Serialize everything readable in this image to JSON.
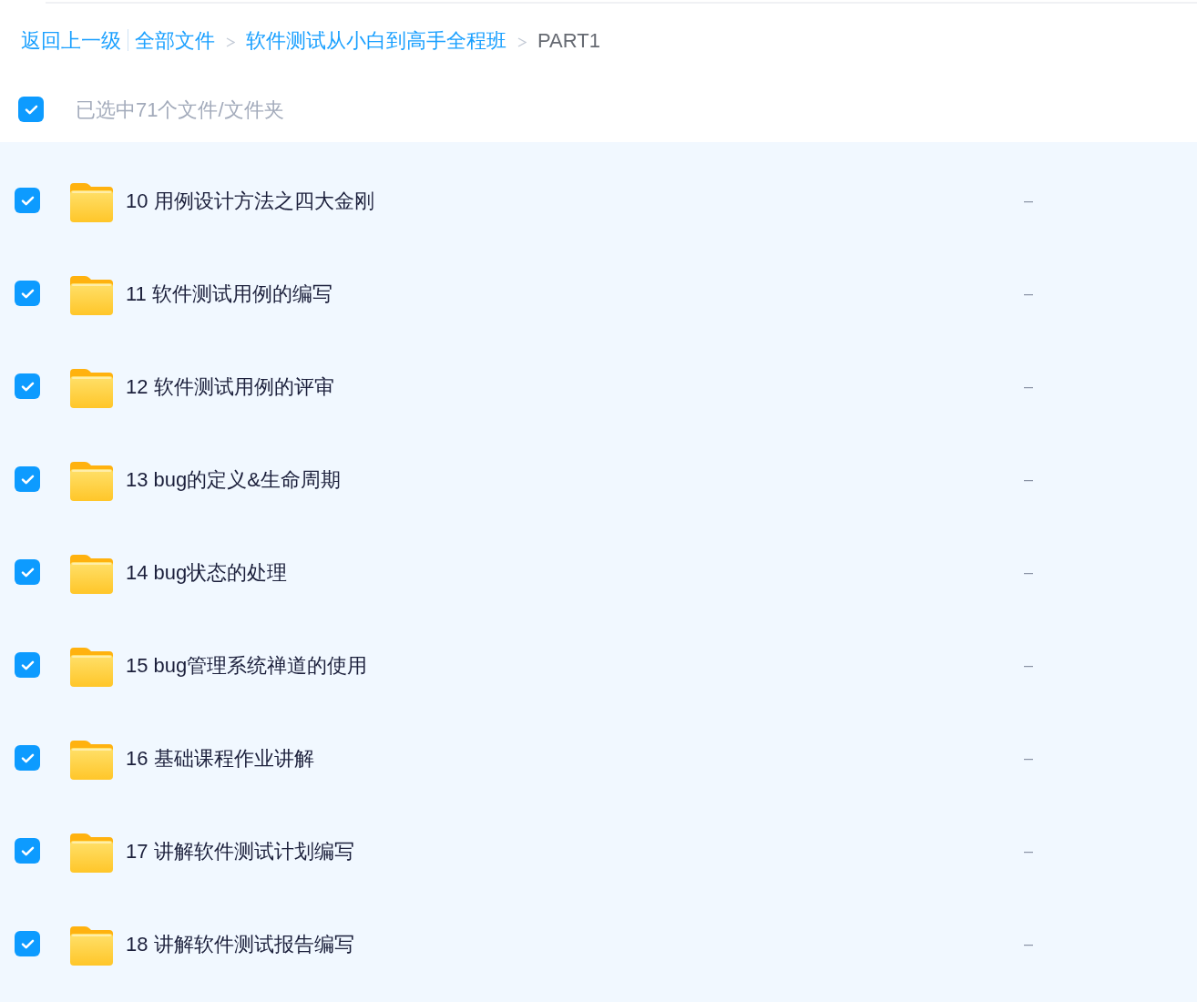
{
  "breadcrumb": {
    "back_link": "返回上一级",
    "items": [
      {
        "label": "全部文件",
        "current": false
      },
      {
        "label": "软件测试从小白到高手全程班",
        "current": false
      },
      {
        "label": "PART1",
        "current": true
      }
    ]
  },
  "select_all": {
    "checked": true,
    "label": "已选中71个文件/文件夹"
  },
  "files": [
    {
      "name": "10 用例设计方法之四大金刚",
      "checked": true,
      "size": "–"
    },
    {
      "name": "11 软件测试用例的编写",
      "checked": true,
      "size": "–"
    },
    {
      "name": "12 软件测试用例的评审",
      "checked": true,
      "size": "–"
    },
    {
      "name": "13 bug的定义&生命周期",
      "checked": true,
      "size": "–"
    },
    {
      "name": "14 bug状态的处理",
      "checked": true,
      "size": "–"
    },
    {
      "name": "15 bug管理系统禅道的使用",
      "checked": true,
      "size": "–"
    },
    {
      "name": "16 基础课程作业讲解",
      "checked": true,
      "size": "–"
    },
    {
      "name": "17 讲解软件测试计划编写",
      "checked": true,
      "size": "–"
    },
    {
      "name": "18 讲解软件测试报告编写",
      "checked": true,
      "size": "–"
    }
  ]
}
